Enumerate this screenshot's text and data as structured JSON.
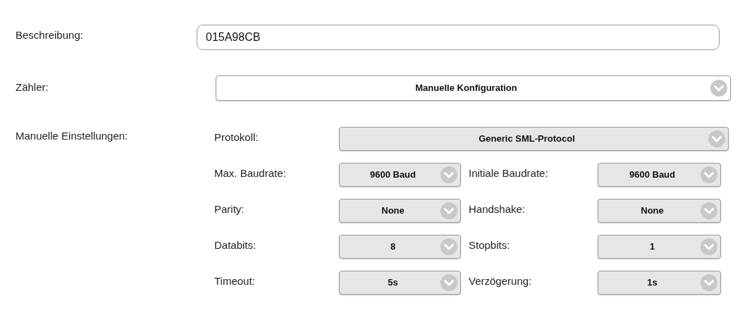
{
  "beschreibung": {
    "label": "Beschreibung:",
    "value": "015A98CB"
  },
  "zaehler": {
    "label": "Zähler:",
    "value": "Manuelle Konfiguration"
  },
  "manuelle_einstellungen": {
    "label": "Manuelle Einstellungen:",
    "protokoll": {
      "label": "Protokoll:",
      "value": "Generic SML-Protocol"
    },
    "rows": [
      [
        {
          "label": "Max. Baudrate:",
          "value": "9600 Baud"
        },
        {
          "label": "Initiale Baudrate:",
          "value": "9600 Baud"
        }
      ],
      [
        {
          "label": "Parity:",
          "value": "None"
        },
        {
          "label": "Handshake:",
          "value": "None"
        }
      ],
      [
        {
          "label": "Databits:",
          "value": "8"
        },
        {
          "label": "Stopbits:",
          "value": "1"
        }
      ],
      [
        {
          "label": "Timeout:",
          "value": "5s"
        },
        {
          "label": "Verzögerung:",
          "value": "1s"
        }
      ]
    ]
  }
}
